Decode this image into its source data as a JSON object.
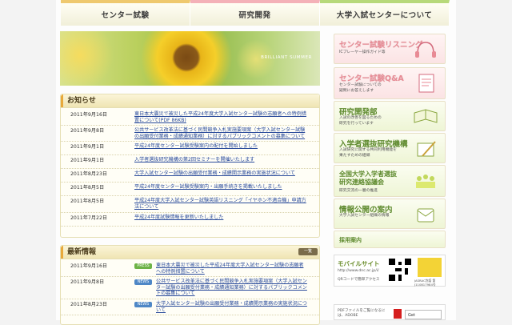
{
  "nav": {
    "items": [
      "センター試験",
      "研究開発",
      "大学入試センターについて"
    ]
  },
  "hero": {
    "caption": "BRILLIANT SUMMER"
  },
  "notices": {
    "heading": "お知らせ",
    "items": [
      {
        "date": "2011年9月16日",
        "title": "東日本大震災で被災した平成24年度大学入試センター試験の志願者への特例措置について(PDF 86KB)"
      },
      {
        "date": "2011年9月8日",
        "title": "公共サービス改革法に基づく民間競争入札実施要項案（大学入試センター試験の出願受付業務・成績通知業務）に対するパブリックコメントの募集について"
      },
      {
        "date": "2011年9月1日",
        "title": "平成24年度センター試験受験案内の配付を開始しました"
      },
      {
        "date": "2011年9月1日",
        "title": "入学者選抜研究機構の第2回セミナーを開催いたします"
      },
      {
        "date": "2011年8月23日",
        "title": "大学入試センター試験の出願受付業務・成績開示業務の実施状況について"
      },
      {
        "date": "2011年8月5日",
        "title": "平成24年度センター試験受験案内・出願手続きを掲載いたしました"
      },
      {
        "date": "2011年8月5日",
        "title": "平成24年度大学入試センター試験英語リスニング「イヤホン不適合機」申請方法について"
      },
      {
        "date": "2011年7月22日",
        "title": "平成24年度試験情報を更新いたしました"
      }
    ]
  },
  "latest": {
    "heading": "最新情報",
    "more_label": "一覧",
    "items": [
      {
        "date": "2011年9月16日",
        "tag": "PRESS",
        "tag_type": "press",
        "title": "東日本大震災で被災した平成24年度大学入試センター試験の志願者への特例措置について"
      },
      {
        "date": "2011年9月8日",
        "tag": "NEWS",
        "tag_type": "news",
        "title": "公共サービス改革法に基づく民間競争入札実施要項案（大学入試センター試験の出願受付業務・成績通知業務）に対するパブリックコメントの募集について"
      },
      {
        "date": "2011年8月23日",
        "tag": "NEWS",
        "tag_type": "news",
        "title": "大学入試センター試験の出願受付業務・成績開示業務の実施状況について"
      }
    ]
  },
  "sidebar": {
    "listening": {
      "title": "センター試験リスニング",
      "sub": "ICプレーヤー操作ガイド等"
    },
    "qa": {
      "title": "センター試験Q&A",
      "sub1": "センター試験についての",
      "sub2": "疑問にお答えします"
    },
    "rd": {
      "title": "研究開発部",
      "sub1": "入試の改善を図るための",
      "sub2": "研究を行っています"
    },
    "admission": {
      "title": "入学者選抜研究機構",
      "sub1": "入試研究に関する共同利用機能を",
      "sub2": "果たすための組織"
    },
    "council": {
      "title1": "全国大学入学者選抜",
      "title2": "研究連絡協議会",
      "sub": "研究交流の一層の推進"
    },
    "disclosure": {
      "title": "情報公開の案内",
      "sub": "大学入試センター組織の情報"
    },
    "recruit": {
      "title": "採用案内"
    },
    "mobile": {
      "title": "モバイルサイト",
      "url": "http://www.dnc.ac.jp/i/",
      "qr_note": "QRコードで簡単アクセス",
      "jasrac": "JASRAC許諾 第J110817984号"
    },
    "pdf": {
      "text1": "PDFファイルをご覧になるには、ADOBE",
      "get": "Get"
    }
  },
  "colors": {
    "link": "#2a4b9b",
    "accent": "#e8a93b"
  }
}
